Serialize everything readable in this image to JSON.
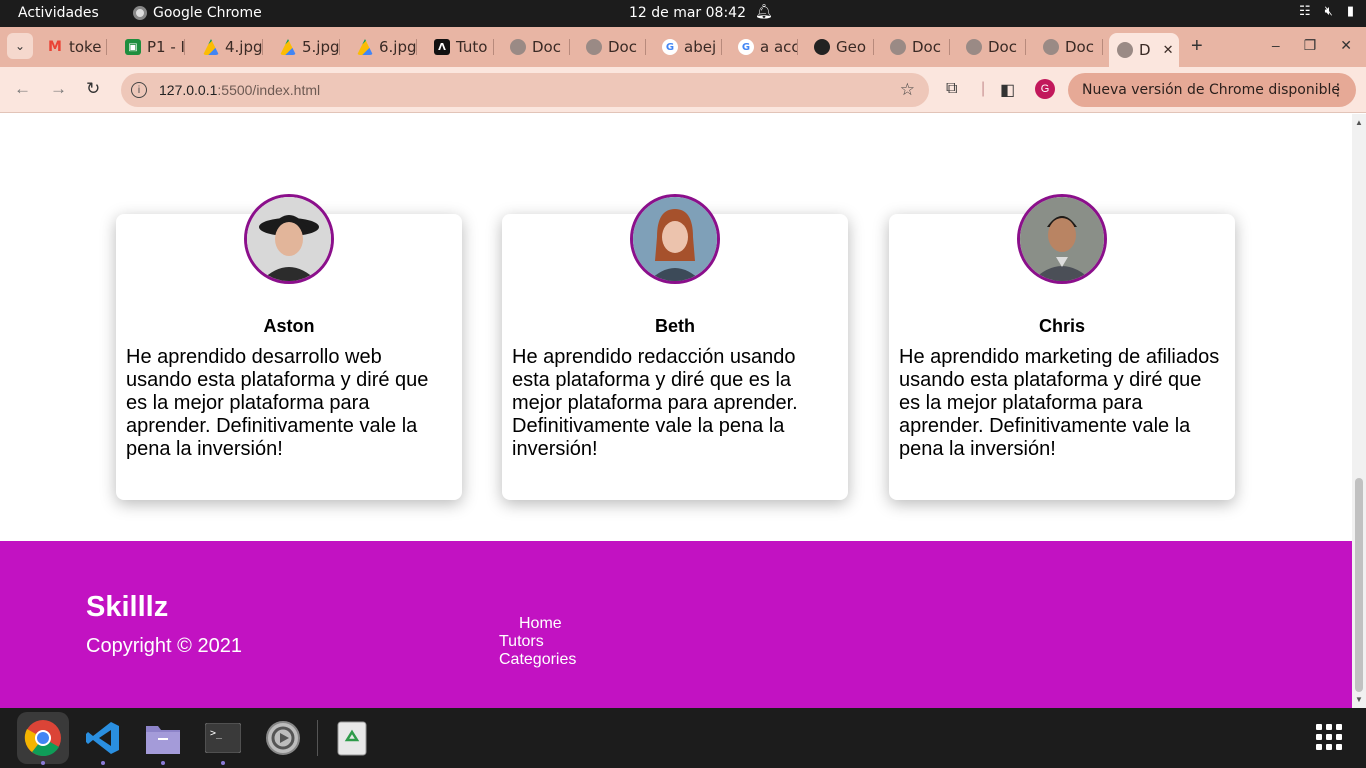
{
  "system": {
    "activities": "Actividades",
    "app_name": "Google Chrome",
    "clock": "12 de mar  08:42"
  },
  "tabs": [
    {
      "label": "toke",
      "icon": "gmail-icon",
      "color": "#ea4335"
    },
    {
      "label": "P1 - I",
      "icon": "classroom-icon",
      "color": "#1e8e3e"
    },
    {
      "label": "4.jpg",
      "icon": "drive-icon",
      "color": "#fbbc04"
    },
    {
      "label": "5.jpg",
      "icon": "drive-icon",
      "color": "#fbbc04"
    },
    {
      "label": "6.jpg",
      "icon": "drive-icon",
      "color": "#fbbc04"
    },
    {
      "label": "Tuto",
      "icon": "tutorial-icon",
      "color": "#111111"
    },
    {
      "label": "Doc",
      "icon": "globe-icon",
      "color": "#9a8a85"
    },
    {
      "label": "Doc",
      "icon": "globe-icon",
      "color": "#9a8a85"
    },
    {
      "label": "abej",
      "icon": "google-icon",
      "color": "#4285f4"
    },
    {
      "label": "a acc",
      "icon": "google-icon",
      "color": "#4285f4"
    },
    {
      "label": "Geo",
      "icon": "github-icon",
      "color": "#222222"
    },
    {
      "label": "Doc",
      "icon": "globe-icon",
      "color": "#9a8a85"
    },
    {
      "label": "Doc",
      "icon": "globe-icon",
      "color": "#9a8a85"
    },
    {
      "label": "Doc",
      "icon": "globe-icon",
      "color": "#9a8a85"
    },
    {
      "label": "D",
      "icon": "globe-icon",
      "color": "#9a8a85",
      "active": true
    }
  ],
  "toolbar": {
    "url_host": "127.0.0.1",
    "url_path": ":5500/index.html",
    "profile_initial": "G",
    "update_label": "Nueva versión de Chrome disponible"
  },
  "testimonials": [
    {
      "name": "Aston",
      "quote": "He aprendido desarrollo web usando esta plataforma y diré que es la mejor plataforma para aprender. Definitivamente vale la pena la inversión!"
    },
    {
      "name": "Beth",
      "quote": "He aprendido redacción usando esta plataforma y diré que es la mejor plataforma para aprender. Definitivamente vale la pena la inversión!"
    },
    {
      "name": "Chris",
      "quote": "He aprendido marketing de afiliados usando esta plataforma y diré que es la mejor plataforma para aprender. Definitivamente vale la pena la inversión!"
    }
  ],
  "footer": {
    "brand": "Skilllz",
    "copyright": "Copyright © 2021",
    "links": [
      "Home",
      "Tutors",
      "Categories"
    ]
  },
  "colors": {
    "footer_bg": "#c212c2",
    "avatar_border": "#8b0f8b",
    "chrome_frame": "#e8b5a4"
  }
}
